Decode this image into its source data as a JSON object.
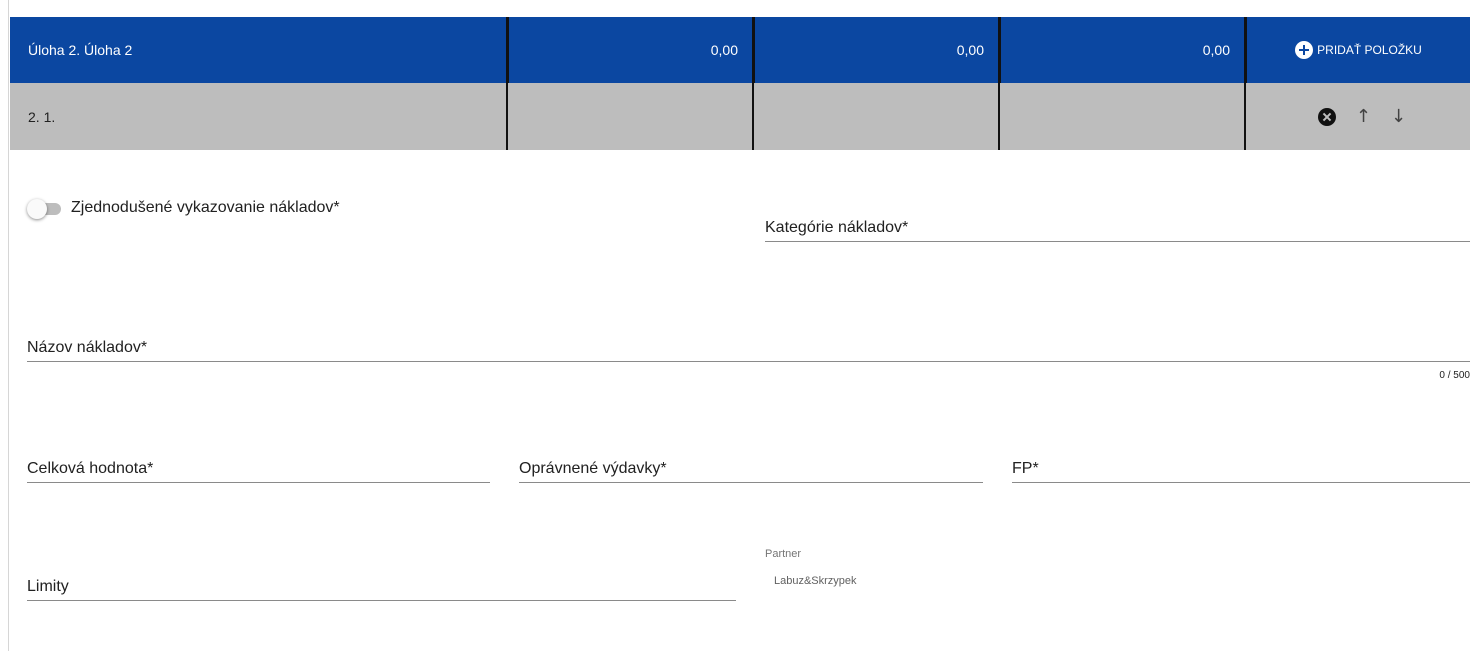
{
  "task_row": {
    "title": "Úloha 2. Úloha 2",
    "values": [
      "0,00",
      "0,00",
      "0,00"
    ],
    "add_item_label": "PRIDAŤ POLOŽKU"
  },
  "sub_row": {
    "number": "2. 1.",
    "values": [
      "",
      "",
      ""
    ]
  },
  "toggle": {
    "label": "Zjednodušené vykazovanie nákladov*",
    "checked": false
  },
  "fields": {
    "cost_category": "Kategórie nákladov*",
    "cost_name": "Názov nákladov*",
    "cost_name_counter": "0 / 500",
    "total_value": "Celková hodnota*",
    "eligible_expenses": "Oprávnené výdavky*",
    "fp": "FP*",
    "limits": "Limity"
  },
  "partner": {
    "label": "Partner",
    "value": "Labuz&Skrzypek"
  },
  "colors": {
    "task_row_bg": "#0b47a1",
    "sub_row_bg": "#bdbdbd"
  },
  "icons": {
    "add": "plus-circle-icon",
    "delete": "close-circle-icon",
    "up": "arrow-up-icon",
    "down": "arrow-down-icon"
  }
}
